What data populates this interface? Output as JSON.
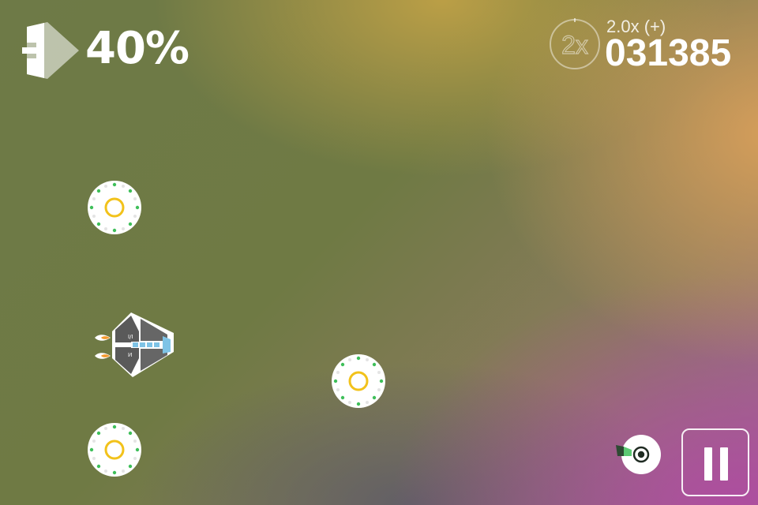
{
  "hud": {
    "boost_percent": "40%",
    "boost_level": 0.4,
    "multiplier_ring_text": "2x",
    "multiplier_label": "2.0x (+)",
    "score": "031385"
  },
  "icons": {
    "boost": "boost-meter-icon",
    "multiplier": "multiplier-ring-icon",
    "pause": "pause-icon",
    "orb": "energy-orb",
    "ship": "player-ship",
    "enemy": "enemy-drone"
  },
  "colors": {
    "hud_text": "#ffffff",
    "orb_ring": "#f2c21b",
    "orb_dots": "#3fbf5a",
    "ship_body": "#5a5a5a",
    "ship_cockpit": "#7ec3e6",
    "engine_flame": "#f39a2c",
    "drone_accent": "#2e7d3a"
  }
}
